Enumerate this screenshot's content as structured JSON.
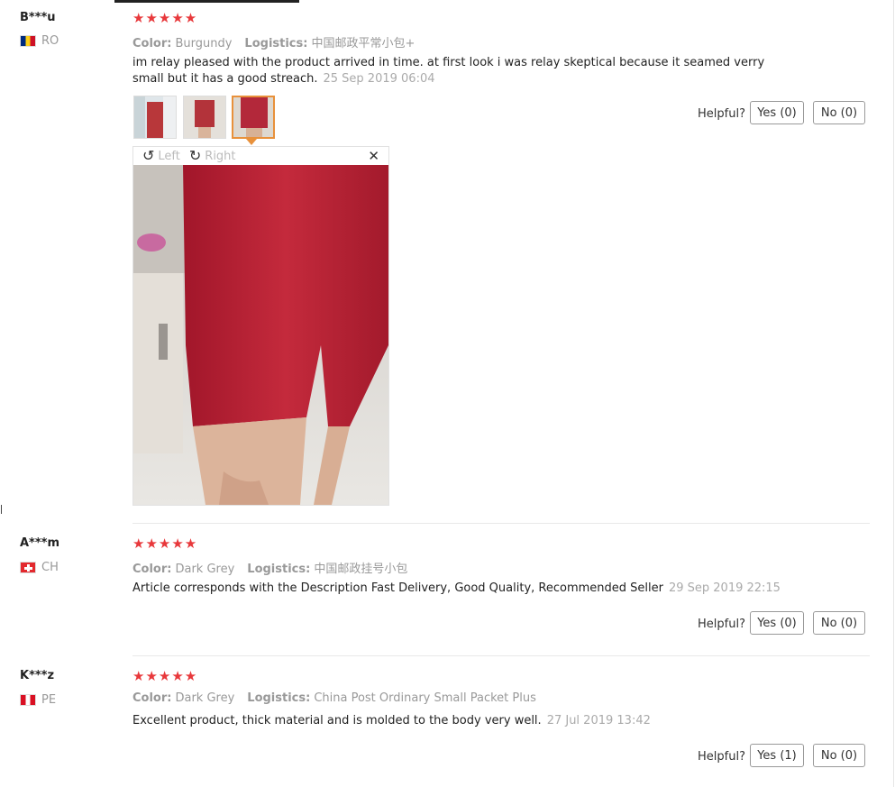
{
  "colors": {
    "star": "#e8383b",
    "accent": "#e8913b"
  },
  "labels": {
    "color": "Color:",
    "logistics": "Logistics:",
    "helpful": "Helpful?"
  },
  "viewer": {
    "left": "Left",
    "right": "Right",
    "close_icon": "close-icon"
  },
  "reviews": [
    {
      "user": "B***u",
      "country": "RO",
      "stars": "★★★★★",
      "color": "Burgundy",
      "logistics": "中国邮政平常小包+",
      "text": "im relay pleased with the product arrived in time. at first look i was relay skeptical because it seamed verry small but it has a good streach.",
      "time": "25 Sep 2019 06:04",
      "yes": "Yes (0)",
      "no": "No (0)"
    },
    {
      "user": "A***m",
      "country": "CH",
      "stars": "★★★★★",
      "color": "Dark Grey",
      "logistics": "中国邮政挂号小包",
      "text": "Article corresponds with the Description Fast Delivery, Good Quality, Recommended Seller",
      "time": "29 Sep 2019 22:15",
      "yes": "Yes (0)",
      "no": "No (0)"
    },
    {
      "user": "K***z",
      "country": "PE",
      "stars": "★★★★★",
      "color": "Dark Grey",
      "logistics": "China Post Ordinary Small Packet Plus",
      "text": "Excellent product, thick material and is molded to the body very well.",
      "time": "27 Jul 2019 13:42",
      "yes": "Yes (1)",
      "no": "No (0)"
    }
  ]
}
